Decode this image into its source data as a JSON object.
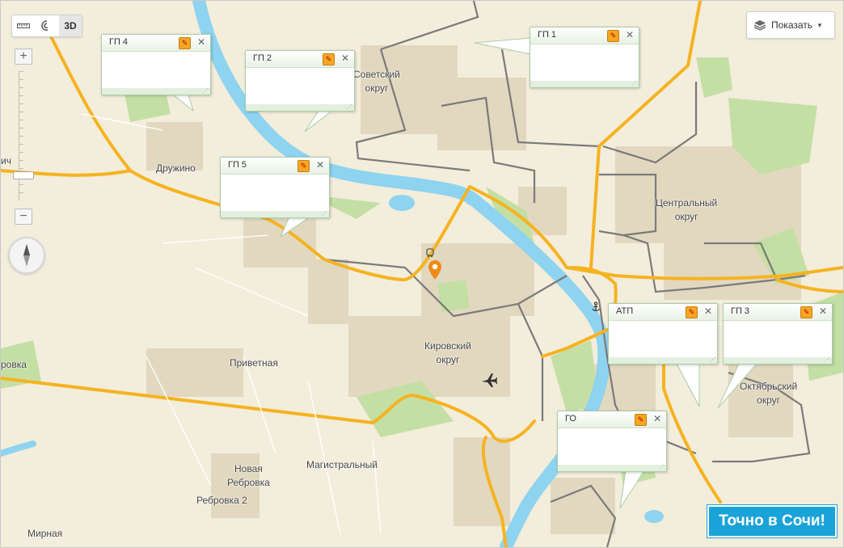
{
  "map": {
    "colors": {
      "land": "#f3eddc",
      "water": "#8ed3ef",
      "park": "#c4dfa4",
      "built": "#e2d8c0",
      "major_road": "#f5b320",
      "district_border": "#7a7a7a"
    },
    "labels": {
      "sovetsky": [
        "Советский",
        "округ"
      ],
      "tsentralny": [
        "Центральный",
        "округ"
      ],
      "kirovsky": [
        "Кировский",
        "округ"
      ],
      "oktyabrsky": [
        "Октябрьский",
        "округ"
      ],
      "druzhino": "Дружино",
      "privetnaya": "Приветная",
      "novaya_rebrovka": [
        "Новая",
        "Ребровка"
      ],
      "rebrovka_2": "Ребровка 2",
      "magistralny": "Магистральный",
      "mirnaya": "Мирная",
      "edge_left_1": "ровка",
      "edge_left_2": "ич"
    },
    "markers": [
      {
        "name": "location-pin-icon",
        "color": "#f08a18"
      },
      {
        "name": "bus-stop-icon"
      },
      {
        "name": "airport-icon"
      },
      {
        "name": "port-anchor-icon"
      }
    ]
  },
  "controls": {
    "toolbar": [
      {
        "icon": "ruler-icon"
      },
      {
        "icon": "route-icon"
      },
      {
        "label": "3D"
      }
    ],
    "zoom_in": "+",
    "zoom_out": "−",
    "compass": "compass-icon",
    "layers": {
      "icon": "layers-icon",
      "label": "Показать"
    }
  },
  "balloons": [
    {
      "id": "gp4",
      "title": "ГП 4"
    },
    {
      "id": "gp2",
      "title": "ГП 2"
    },
    {
      "id": "gp1",
      "title": "ГП 1"
    },
    {
      "id": "gp5",
      "title": "ГП 5"
    },
    {
      "id": "atp",
      "title": "АТП"
    },
    {
      "id": "gp3",
      "title": "ГП 3"
    },
    {
      "id": "go",
      "title": "ГО"
    }
  ],
  "ad": {
    "label": "Точно в Сочи!"
  }
}
